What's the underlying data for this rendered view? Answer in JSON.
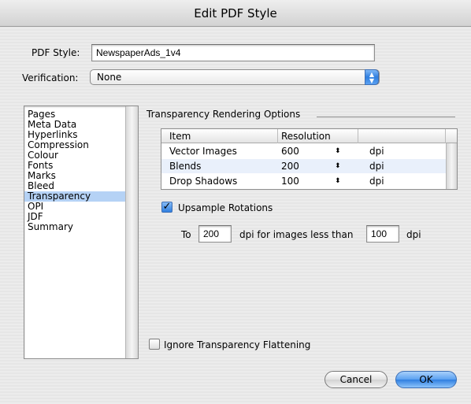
{
  "window": {
    "title": "Edit PDF Style"
  },
  "pdf_style": {
    "label": "PDF Style:",
    "value": "NewspaperAds_1v4"
  },
  "verification": {
    "label": "Verification:",
    "value": "None"
  },
  "sidebar": {
    "items": [
      {
        "label": "Pages"
      },
      {
        "label": "Meta Data"
      },
      {
        "label": "Hyperlinks"
      },
      {
        "label": "Compression"
      },
      {
        "label": "Colour"
      },
      {
        "label": "Fonts"
      },
      {
        "label": "Marks"
      },
      {
        "label": "Bleed"
      },
      {
        "label": "Transparency",
        "selected": true
      },
      {
        "label": "OPI"
      },
      {
        "label": "JDF"
      },
      {
        "label": "Summary"
      }
    ]
  },
  "transparency": {
    "section_title": "Transparency Rendering Options",
    "table": {
      "headers": {
        "item": "Item",
        "resolution": "Resolution"
      },
      "rows": [
        {
          "item": "Vector Images",
          "resolution": "600",
          "unit": "dpi"
        },
        {
          "item": "Blends",
          "resolution": "200",
          "unit": "dpi"
        },
        {
          "item": "Drop Shadows",
          "resolution": "100",
          "unit": "dpi"
        }
      ]
    },
    "upsample": {
      "label": "Upsample Rotations",
      "checked": true,
      "to_label": "To",
      "to_value": "200",
      "middle_label": "dpi for images less than",
      "less_than_value": "100",
      "unit_label": "dpi"
    },
    "ignore_flattening": {
      "label": "Ignore Transparency Flattening",
      "checked": false
    }
  },
  "buttons": {
    "cancel": "Cancel",
    "ok": "OK"
  },
  "glyphs": {
    "check": "✓",
    "up_down": "▲▼",
    "stepper": "⬍"
  }
}
